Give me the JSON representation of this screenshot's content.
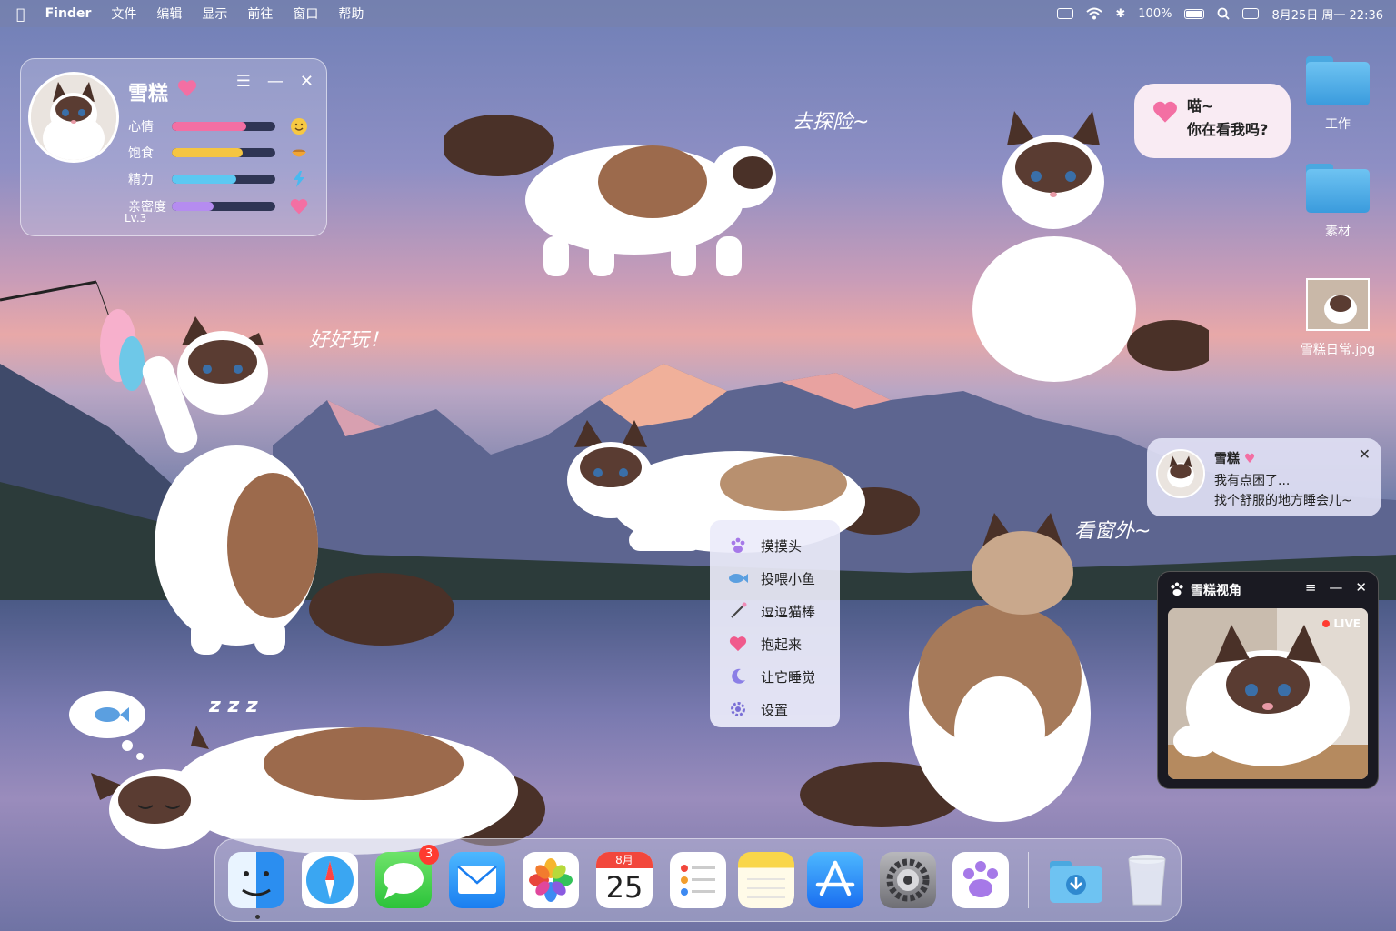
{
  "menubar": {
    "app": "Finder",
    "menus": [
      "文件",
      "编辑",
      "显示",
      "前往",
      "窗口",
      "帮助"
    ],
    "battery": "100%",
    "datetime": "8月25日 周一 22:36"
  },
  "pet_panel": {
    "name": "雪糕",
    "stats": [
      {
        "label": "心情",
        "value": 0.72,
        "color": "#f36fa3",
        "icon": "smile-icon"
      },
      {
        "label": "饱食",
        "value": 0.68,
        "color": "#f5c542",
        "icon": "food-bowl-icon"
      },
      {
        "label": "精力",
        "value": 0.62,
        "color": "#5cc8f2",
        "icon": "lightning-icon"
      },
      {
        "label": "亲密度",
        "value": 0.4,
        "color": "#b58cf0",
        "icon": "heart-icon"
      }
    ],
    "level": "Lv.3"
  },
  "captions": {
    "adventure": "去探险~",
    "fun": "好好玩！",
    "window": "看窗外~",
    "sleep": "z z z"
  },
  "speech_bubble": {
    "line1": "喵~",
    "line2": "你在看我吗?"
  },
  "desktop_icons": [
    {
      "label": "工作",
      "type": "folder"
    },
    {
      "label": "素材",
      "type": "folder"
    },
    {
      "label": "雪糕日常.jpg",
      "type": "image"
    }
  ],
  "notification": {
    "title": "雪糕",
    "line1": "我有点困了...",
    "line2": "找个舒服的地方睡会儿~"
  },
  "context_menu": [
    {
      "label": "摸摸头",
      "icon": "paw-icon"
    },
    {
      "label": "投喂小鱼",
      "icon": "fish-icon"
    },
    {
      "label": "逗逗猫棒",
      "icon": "cat-wand-icon"
    },
    {
      "label": "抱起来",
      "icon": "heart-icon"
    },
    {
      "label": "让它睡觉",
      "icon": "moon-icon"
    },
    {
      "label": "设置",
      "icon": "gear-icon"
    }
  ],
  "camera": {
    "title": "雪糕视角",
    "live": "LIVE"
  },
  "dock": {
    "calendar_month": "8月",
    "calendar_day": "25",
    "messages_badge": "3",
    "apps": [
      "finder",
      "safari",
      "messages",
      "mail",
      "photos",
      "calendar",
      "reminders",
      "notes",
      "app-store",
      "system-settings",
      "pet-app",
      "downloads",
      "trash"
    ]
  }
}
